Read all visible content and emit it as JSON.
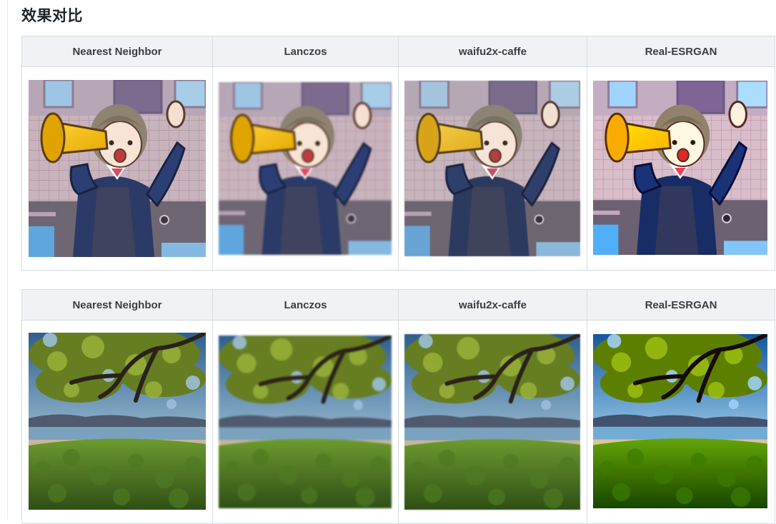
{
  "heading": "效果对比",
  "methods": [
    "Nearest Neighbor",
    "Lanczos",
    "waifu2x-caffe",
    "Real-ESRGAN"
  ],
  "comparisons": [
    {
      "images": [
        {
          "alt": "anime-girl-megaphone",
          "style": "pixelated"
        },
        {
          "alt": "anime-girl-megaphone",
          "style": "blurry"
        },
        {
          "alt": "anime-girl-megaphone",
          "style": "smooth"
        },
        {
          "alt": "anime-girl-megaphone",
          "style": "sharp"
        }
      ]
    },
    {
      "images": [
        {
          "alt": "tree-seaside-landscape",
          "style": "pixelated"
        },
        {
          "alt": "tree-seaside-landscape",
          "style": "blurry"
        },
        {
          "alt": "tree-seaside-landscape",
          "style": "smooth"
        },
        {
          "alt": "tree-seaside-landscape",
          "style": "sharp"
        }
      ]
    }
  ]
}
